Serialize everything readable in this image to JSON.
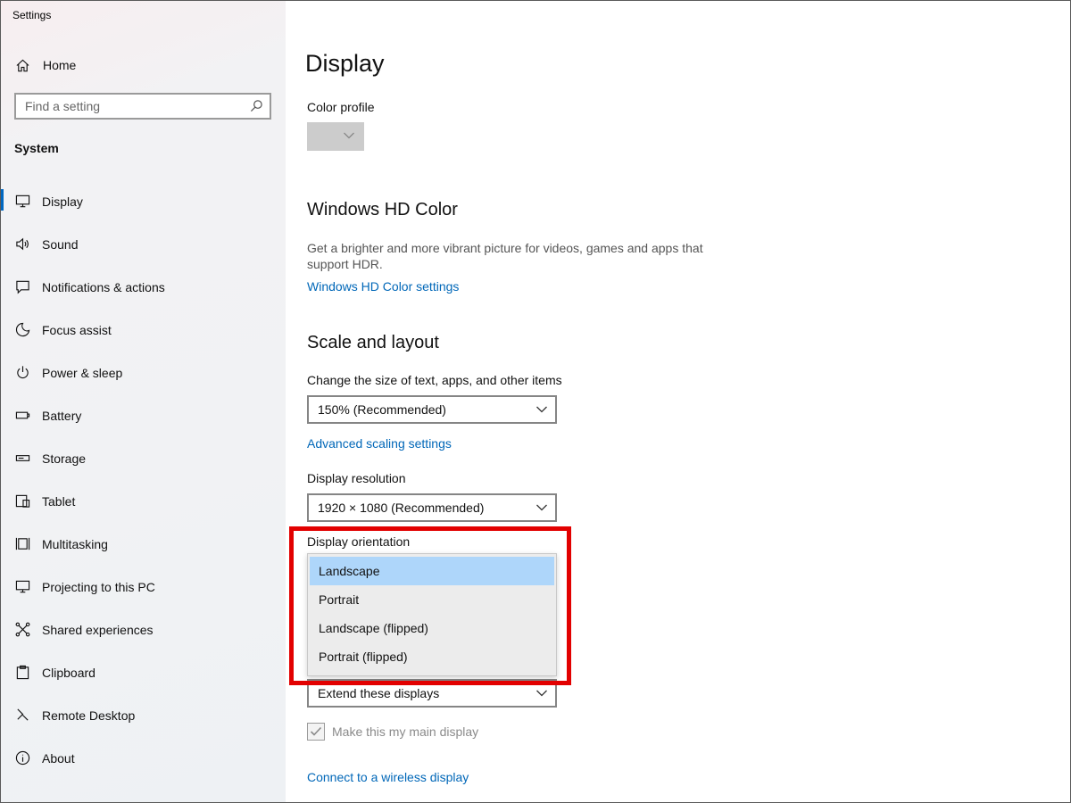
{
  "window": {
    "title": "Settings"
  },
  "sidebar": {
    "home_label": "Home",
    "search_placeholder": "Find a setting",
    "section": "System",
    "items": [
      {
        "label": "Display",
        "icon": "monitor-icon",
        "active": true
      },
      {
        "label": "Sound",
        "icon": "speaker-icon"
      },
      {
        "label": "Notifications & actions",
        "icon": "notification-icon"
      },
      {
        "label": "Focus assist",
        "icon": "moon-icon"
      },
      {
        "label": "Power & sleep",
        "icon": "power-icon"
      },
      {
        "label": "Battery",
        "icon": "battery-icon"
      },
      {
        "label": "Storage",
        "icon": "storage-icon"
      },
      {
        "label": "Tablet",
        "icon": "tablet-icon"
      },
      {
        "label": "Multitasking",
        "icon": "multitasking-icon"
      },
      {
        "label": "Projecting to this PC",
        "icon": "projecting-icon"
      },
      {
        "label": "Shared experiences",
        "icon": "shared-icon"
      },
      {
        "label": "Clipboard",
        "icon": "clipboard-icon"
      },
      {
        "label": "Remote Desktop",
        "icon": "remote-desktop-icon"
      },
      {
        "label": "About",
        "icon": "info-icon"
      }
    ]
  },
  "main": {
    "title": "Display",
    "color_profile": {
      "label": "Color profile"
    },
    "hd_color": {
      "heading": "Windows HD Color",
      "description": "Get a brighter and more vibrant picture for videos, games and apps that support HDR.",
      "link": "Windows HD Color settings"
    },
    "scale_layout": {
      "heading": "Scale and layout",
      "size_label": "Change the size of text, apps, and other items",
      "size_value": "150% (Recommended)",
      "advanced_link": "Advanced scaling settings",
      "resolution_label": "Display resolution",
      "resolution_value": "1920 × 1080 (Recommended)",
      "orientation_label": "Display orientation",
      "orientation_options": [
        "Landscape",
        "Portrait",
        "Landscape (flipped)",
        "Portrait (flipped)"
      ],
      "orientation_selected": "Landscape"
    },
    "multiple_displays": {
      "value": "Extend these displays",
      "main_display_label": "Make this my main display",
      "main_display_checked": true,
      "wireless_link": "Connect to a wireless display"
    }
  },
  "colors": {
    "accent": "#0067c0",
    "link": "#0067b8",
    "highlight": "#e20000",
    "selected_option": "#aed6fa"
  }
}
